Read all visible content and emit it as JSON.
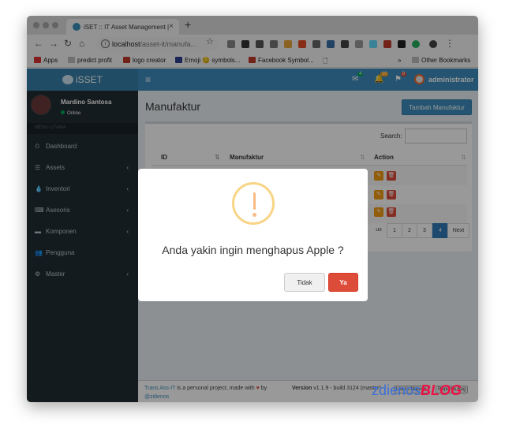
{
  "browser": {
    "tab_title": "iSET :: IT Asset Management |",
    "tab_close": "×",
    "new_tab": "+",
    "url_host": "localhost",
    "url_path": "/asset-it/manufa...",
    "nav_icons": [
      "back-icon",
      "forward-icon",
      "reload-icon",
      "home-icon"
    ],
    "bookmarks": [
      "Apps",
      "predict profit",
      "logo creator",
      "Emoji 😏 symbols...",
      "Facebook Symbol..."
    ],
    "bookmarks_more": "»",
    "other_bookmarks": "Other Bookmarks"
  },
  "app": {
    "brand": "iSSET",
    "user_top": "administrator",
    "badges": [
      "4",
      "10",
      "9"
    ],
    "sidebar": {
      "user_name": "Mardino Santosa",
      "status": "Online",
      "menu_header": "MENU UTAMA",
      "items": [
        {
          "label": "Dashboard",
          "icon": "dashboard-icon",
          "glyph": "⏲",
          "caret": ""
        },
        {
          "label": "Assets",
          "icon": "bars-icon",
          "glyph": "☰",
          "caret": "‹"
        },
        {
          "label": "Inventori",
          "icon": "tint-icon",
          "glyph": "💧",
          "caret": "‹"
        },
        {
          "label": "Asesoris",
          "icon": "keyboard-icon",
          "glyph": "⌨",
          "caret": "‹"
        },
        {
          "label": "Komponen",
          "icon": "hdd-icon",
          "glyph": "▬",
          "caret": "‹"
        },
        {
          "label": "Pengguna",
          "icon": "users-icon",
          "glyph": "👥",
          "caret": ""
        },
        {
          "label": "Master",
          "icon": "cogs-icon",
          "glyph": "⚙",
          "caret": "‹"
        }
      ]
    },
    "page_title": "Manufaktur",
    "add_button": "Tambah Manufaktur",
    "search_label": "Search:",
    "search_value": "",
    "columns": [
      "ID",
      "Manufaktur",
      "Action"
    ],
    "pagination": [
      "us",
      "1",
      "2",
      "3",
      "4",
      "Next"
    ],
    "active_page": "4",
    "footer": {
      "project": "Trans Ass-IT",
      "text1": " is a personal project, made with ",
      "heart": "♥",
      "by": " by",
      "author": "@zdienos",
      "version_label": "Version",
      "version": " v1.1.9 - build 3124 (master)",
      "manual_btn": "User's Manual",
      "bug_btn": "Report a Bug"
    }
  },
  "modal": {
    "message": "Anda yakin ingin menghapus Apple ?",
    "cancel": "Tidak",
    "confirm": "Ya"
  },
  "watermark": {
    "text": "zdienos",
    "blog": "BLOG"
  },
  "colors": {
    "primary": "#3c8dbc",
    "danger": "#dd4b39",
    "warning": "#f39c12",
    "sidebar": "#222d32"
  }
}
